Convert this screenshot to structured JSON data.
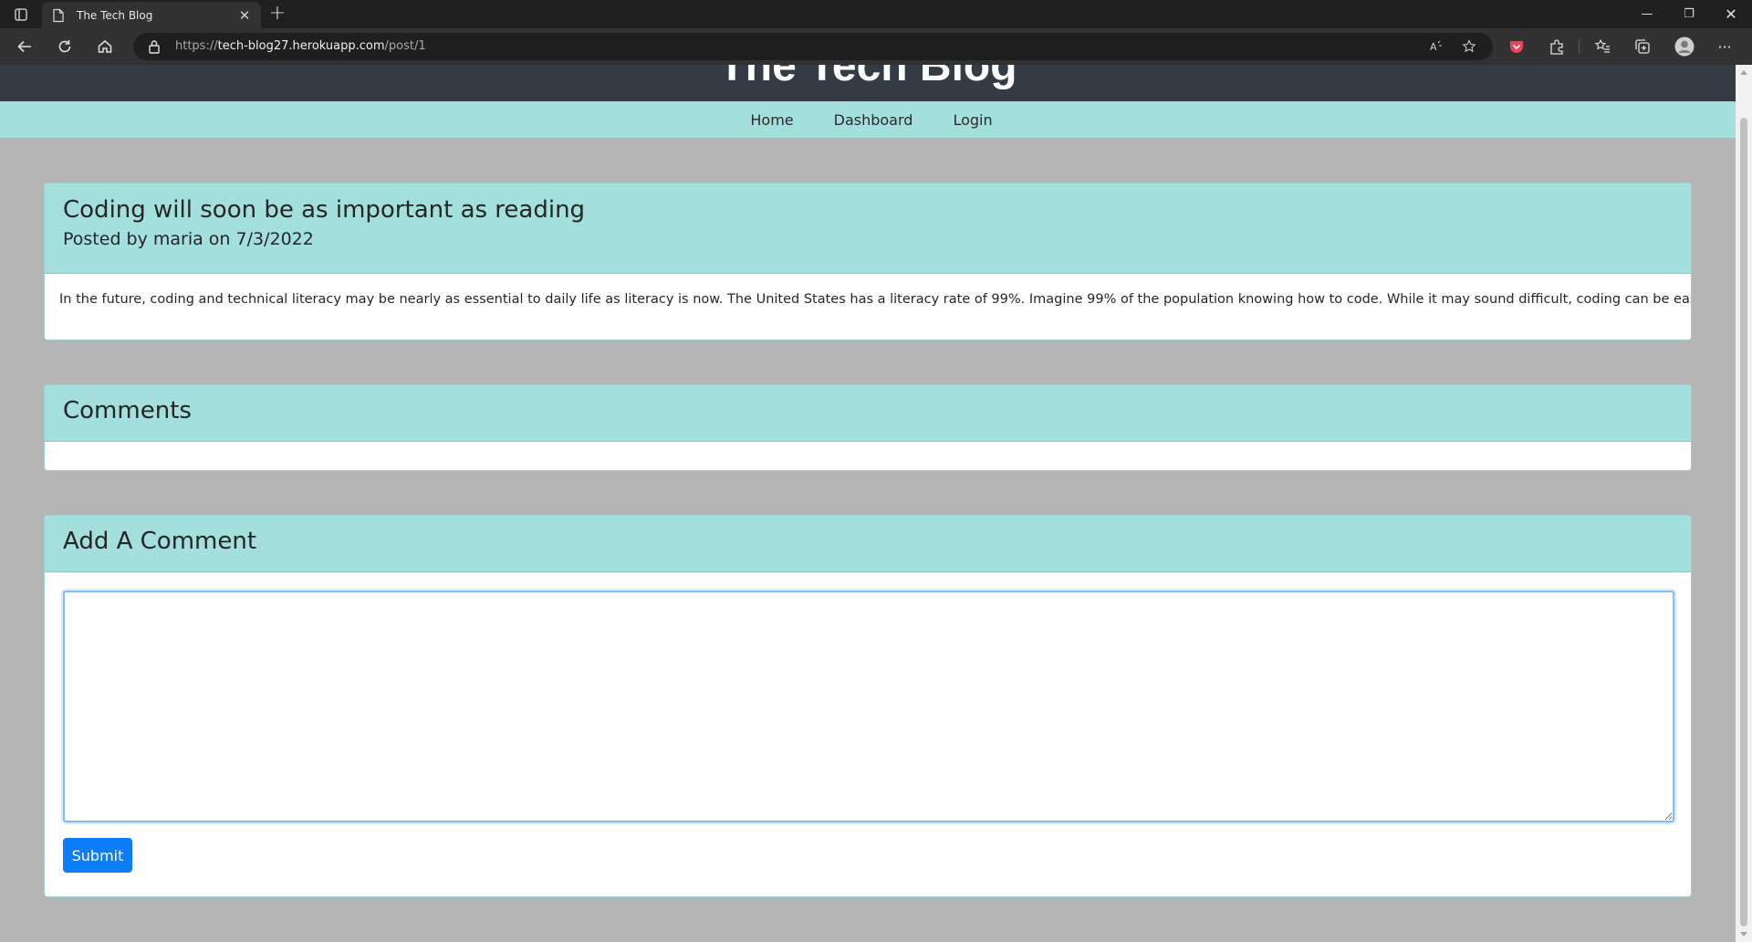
{
  "browser": {
    "tab_title": "The Tech Blog",
    "url_prefix": "https://",
    "url_domain": "tech-blog27.herokuapp.com",
    "url_path": "/post/1"
  },
  "site": {
    "title": "The Tech Blog",
    "nav": [
      "Home",
      "Dashboard",
      "Login"
    ]
  },
  "post": {
    "title": "Coding will soon be as important as reading",
    "meta": "Posted by maria on 7/3/2022",
    "body": "In the future, coding and technical literacy may be nearly as essential to daily life as literacy is now. The United States has a literacy rate of 99%. Imagine 99% of the population knowing how to code. While it may sound difficult, coding can be easier"
  },
  "comments": {
    "heading": "Comments"
  },
  "add_comment": {
    "heading": "Add A Comment",
    "textarea_value": "",
    "submit_label": "Submit"
  },
  "colors": {
    "header_bg": "#353b45",
    "nav_bg": "#a2dfdd",
    "page_bg": "#b5b5b5",
    "button_bg": "#0d7ef9"
  }
}
